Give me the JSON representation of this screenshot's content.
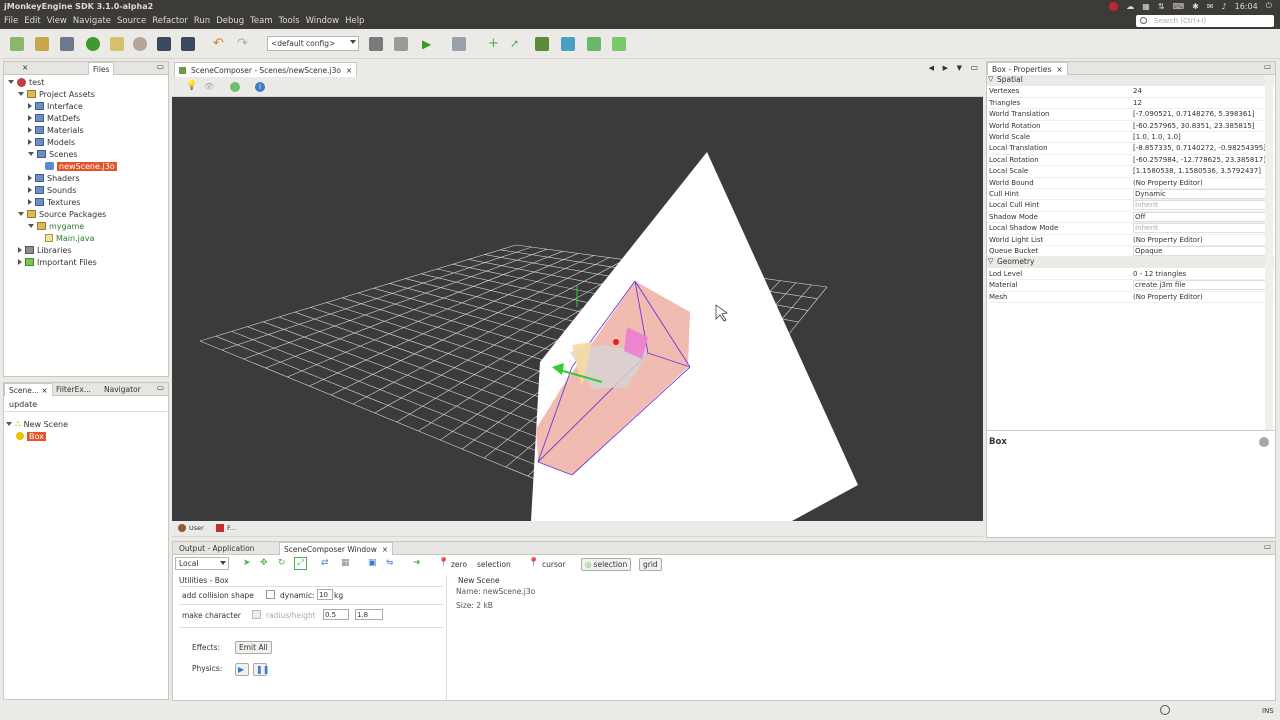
{
  "window": {
    "title": "jMonkeyEngine SDK 3.1.0-alpha2",
    "clock": "16:04"
  },
  "menu": [
    "File",
    "Edit",
    "View",
    "Navigate",
    "Source",
    "Refactor",
    "Run",
    "Debug",
    "Team",
    "Tools",
    "Window",
    "Help"
  ],
  "search": {
    "placeholder": "Search (Ctrl+I)"
  },
  "toolbar": {
    "config_value": "<default config>"
  },
  "projects": {
    "tab_label": "Files",
    "tree": [
      {
        "label": "test",
        "depth": 0,
        "icon": "project"
      },
      {
        "label": "Project Assets",
        "depth": 1,
        "icon": "assets"
      },
      {
        "label": "Interface",
        "depth": 2,
        "icon": "folder"
      },
      {
        "label": "MatDefs",
        "depth": 2,
        "icon": "folder"
      },
      {
        "label": "Materials",
        "depth": 2,
        "icon": "folder"
      },
      {
        "label": "Models",
        "depth": 2,
        "icon": "folder"
      },
      {
        "label": "Scenes",
        "depth": 2,
        "icon": "folder"
      },
      {
        "label": "newScene.j3o",
        "depth": 3,
        "icon": "scene"
      },
      {
        "label": "Shaders",
        "depth": 2,
        "icon": "folder"
      },
      {
        "label": "Sounds",
        "depth": 2,
        "icon": "folder"
      },
      {
        "label": "Textures",
        "depth": 2,
        "icon": "folder"
      },
      {
        "label": "Source Packages",
        "depth": 1,
        "icon": "src"
      },
      {
        "label": "mygame",
        "depth": 2,
        "icon": "package"
      },
      {
        "label": "Main.java",
        "depth": 3,
        "icon": "java"
      },
      {
        "label": "Libraries",
        "depth": 1,
        "icon": "lib"
      },
      {
        "label": "Important Files",
        "depth": 1,
        "icon": "imp"
      }
    ]
  },
  "scene_explorer": {
    "tabs": [
      "Scene...",
      "FilterEx...",
      "Navigator"
    ],
    "search_value": "update",
    "root": "New Scene",
    "child": "Box"
  },
  "editor": {
    "tab": "SceneComposer - Scenes/newScene.j3o",
    "bottom_tabs": [
      "User",
      "F..."
    ]
  },
  "properties": {
    "title": "Box - Properties",
    "sections": [
      {
        "name": "Spatial",
        "rows": [
          {
            "key": "Vertexes",
            "value": "24",
            "style": "plain"
          },
          {
            "key": "Triangles",
            "value": "12",
            "style": "plain"
          },
          {
            "key": "World Translation",
            "value": "[-7.090521, 0.7148276, 5.398361]",
            "style": "plain"
          },
          {
            "key": "World Rotation",
            "value": "[-60.257965, 30.8351, 23.385815]",
            "style": "plain"
          },
          {
            "key": "World Scale",
            "value": "[1.0, 1.0, 1.0]",
            "style": "plain"
          },
          {
            "key": "Local Translation",
            "value": "[-8.857335, 0.7140272, -0.98254395]",
            "style": "plain"
          },
          {
            "key": "Local Rotation",
            "value": "[-60.257984, -12.778625, 23.385817]",
            "style": "plain"
          },
          {
            "key": "Local Scale",
            "value": "[1.1580538, 1.1580536, 3.5792437]",
            "style": "plain"
          },
          {
            "key": "World Bound",
            "value": "(No Property Editor)",
            "style": "plain"
          },
          {
            "key": "Cull Hint",
            "value": "Dynamic",
            "style": "box"
          },
          {
            "key": "Local Cull Hint",
            "value": "Inherit",
            "style": "dim-select"
          },
          {
            "key": "Shadow Mode",
            "value": "Off",
            "style": "box"
          },
          {
            "key": "Local Shadow Mode",
            "value": "Inherit",
            "style": "dim-select"
          },
          {
            "key": "World Light List",
            "value": "(No Property Editor)",
            "style": "plain"
          },
          {
            "key": "Queue Bucket",
            "value": "Opaque",
            "style": "box"
          }
        ]
      },
      {
        "name": "Geometry",
        "rows": [
          {
            "key": "Lod Level",
            "value": "0 - 12 triangles",
            "style": "plain"
          },
          {
            "key": "Material",
            "value": "create j3m file",
            "style": "box"
          },
          {
            "key": "Mesh",
            "value": "(No Property Editor)",
            "style": "plain"
          }
        ]
      }
    ],
    "description_title": "Box"
  },
  "output": {
    "tabs": [
      "Output - Application",
      "SceneComposer Window"
    ],
    "space_select": "Local",
    "zero_label": "zero",
    "selection_label": "selection",
    "cursor_label": "cursor",
    "toggle_selection": "selection",
    "toggle_grid": "grid",
    "utilities_title": "Utilities - Box",
    "add_collision_label": "add collision shape",
    "dynamic_label": "dynamic:",
    "mass_value": "10",
    "mass_unit": "kg",
    "make_character_label": "make character",
    "radius_height_label": "radius/height",
    "radius_value": "0.5",
    "height_value": "1.8",
    "effects_label": "Effects:",
    "emit_all": "Emit All",
    "physics_label": "Physics:",
    "scene_info_title": "New Scene",
    "scene_name": "Name: newScene.j3o",
    "scene_size": "Size: 2 kB"
  },
  "statusbar": {
    "mode": "INS"
  }
}
